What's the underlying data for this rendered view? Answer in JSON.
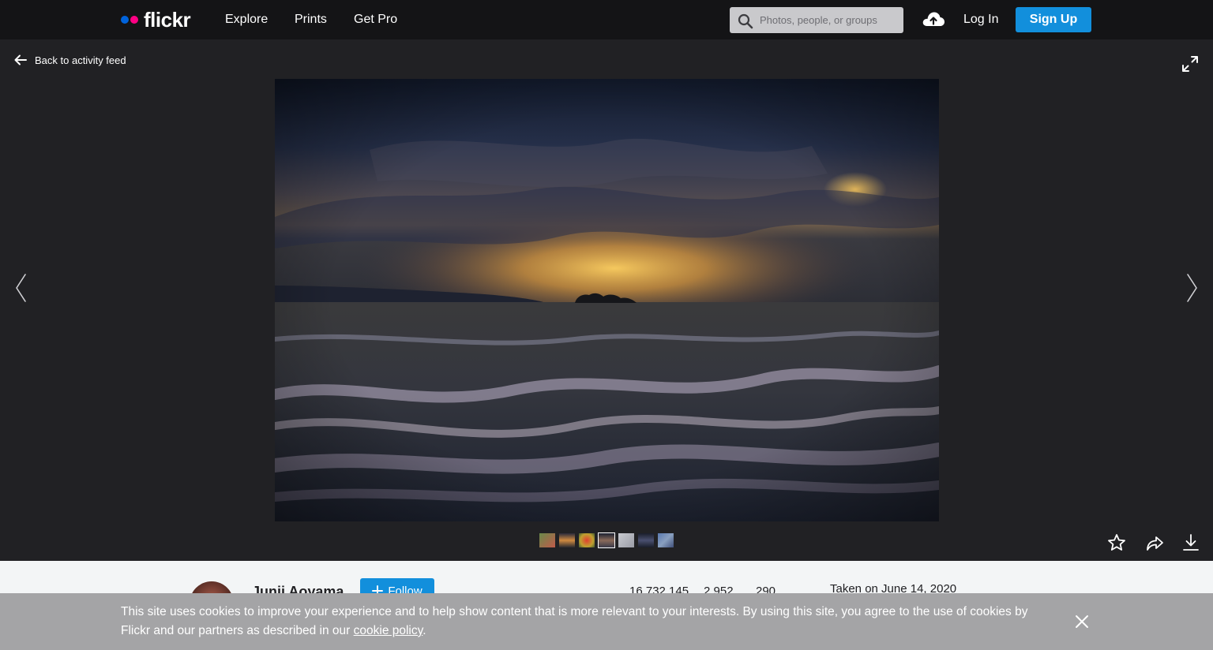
{
  "header": {
    "logo_text": "flickr",
    "nav": [
      "Explore",
      "Prints",
      "Get Pro"
    ],
    "search_placeholder": "Photos, people, or groups",
    "login_label": "Log In",
    "signup_label": "Sign Up"
  },
  "viewer": {
    "back_label": "Back to activity feed"
  },
  "info": {
    "owner_name": "Junji Aoyama",
    "follow_label": "Follow",
    "views": "16,732,145",
    "faves": "2,952",
    "comments": "290",
    "taken": "Taken on June 14, 2020"
  },
  "cookie": {
    "text_before": "This site uses cookies to improve your experience and to help show content that is more relevant to your interests. By using this site, you agree to the use of cookies by Flickr and our partners as described in our ",
    "link_label": "cookie policy",
    "text_after": "."
  },
  "colors": {
    "topbar": "#141416",
    "viewer_bg": "#212124",
    "accent_blue": "#128fdc",
    "logo_blue": "#0063dc",
    "logo_pink": "#ff0084"
  },
  "icons": [
    "search-icon",
    "upload-cloud-icon",
    "back-arrow-icon",
    "expand-icon",
    "prev-arrow-icon",
    "next-arrow-icon",
    "star-icon",
    "share-icon",
    "download-icon",
    "plus-icon",
    "close-icon"
  ]
}
